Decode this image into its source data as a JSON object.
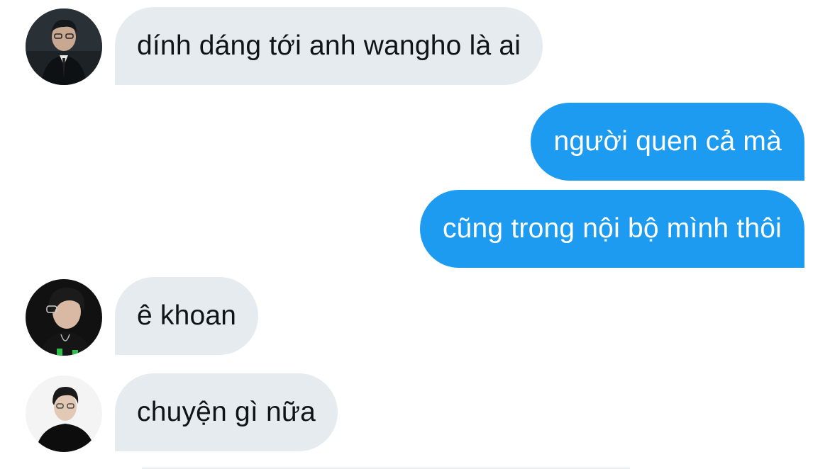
{
  "messages": [
    {
      "direction": "incoming",
      "text": "dính dáng tới anh wangho là ai",
      "avatar": "user-avatar-1"
    },
    {
      "direction": "outgoing",
      "text": "người quen cả mà"
    },
    {
      "direction": "outgoing",
      "text": "cũng trong nội bộ mình thôi"
    },
    {
      "direction": "incoming",
      "text": "ê khoan",
      "avatar": "user-avatar-2"
    },
    {
      "direction": "incoming",
      "text": "chuyện gì nữa",
      "avatar": "user-avatar-3"
    }
  ],
  "colors": {
    "incoming_bubble": "#e6ebef",
    "outgoing_bubble": "#1d9bf0",
    "incoming_text": "#0f1419",
    "outgoing_text": "#ffffff"
  }
}
